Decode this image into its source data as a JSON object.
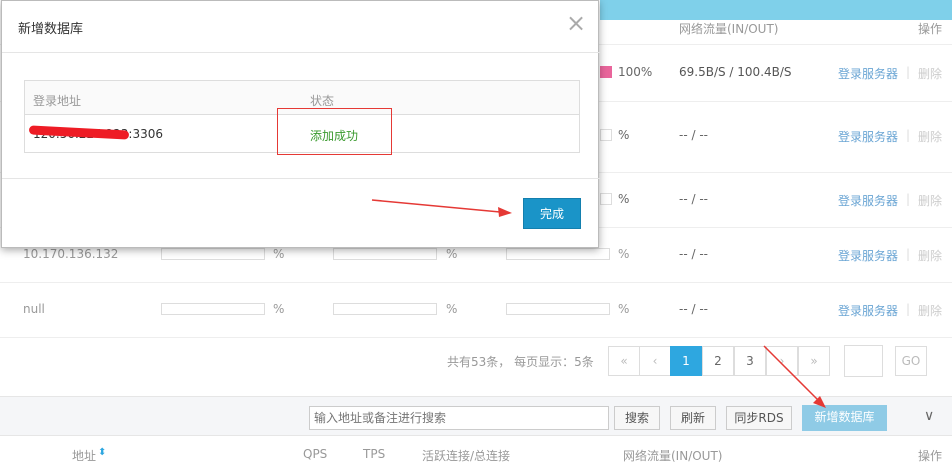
{
  "table": {
    "col_traffic": "网络流量(IN/OUT)",
    "col_action": "操作",
    "rows": [
      {
        "addr": "",
        "pct1": "",
        "pct2": "",
        "pct3": "100%",
        "traffic": "69.5B/S / 100.4B/S",
        "login": "登录服务器",
        "delete": "删除"
      },
      {
        "addr": "",
        "pct1": "",
        "pct2": "",
        "pct3": "%",
        "traffic": "-- / --",
        "login": "登录服务器",
        "delete": "删除"
      },
      {
        "addr": "",
        "pct1": "",
        "pct2": "",
        "pct3": "%",
        "traffic": "-- / --",
        "login": "登录服务器",
        "delete": "删除"
      },
      {
        "addr": "10.170.136.132",
        "pct1": "%",
        "pct2": "%",
        "pct3": "%",
        "traffic": "-- / --",
        "login": "登录服务器",
        "delete": "删除"
      },
      {
        "addr": "null",
        "pct1": "%",
        "pct2": "%",
        "pct3": "%",
        "traffic": "-- / --",
        "login": "登录服务器",
        "delete": "删除"
      }
    ]
  },
  "pagination": {
    "summary": "共有53条， 每页显示：5条",
    "first": "«",
    "prev": "‹",
    "pages": [
      "1",
      "2",
      "3"
    ],
    "next": "›",
    "last": "»",
    "go": "GO"
  },
  "toolbar": {
    "search_placeholder": "输入地址或备注进行搜索",
    "search_btn": "搜索",
    "refresh_btn": "刷新",
    "sync_btn": "同步RDS",
    "add_btn": "新增数据库",
    "chevron": "∨"
  },
  "bottom_header": {
    "addr": "地址",
    "sort": "⬍",
    "qps": "QPS",
    "tps": "TPS",
    "conn": "活跃连接/总连接",
    "traffic": "网络流量(IN/OUT)",
    "action": "操作"
  },
  "modal": {
    "title": "新增数据库",
    "close": "×",
    "col_addr": "登录地址",
    "col_status": "状态",
    "row_addr": "120.56.224.223:3306",
    "row_status": "添加成功",
    "done": "完成"
  },
  "colors": {
    "accent": "#1a94c8",
    "status_success": "#3a9a2e",
    "annotation": "#e53935"
  }
}
